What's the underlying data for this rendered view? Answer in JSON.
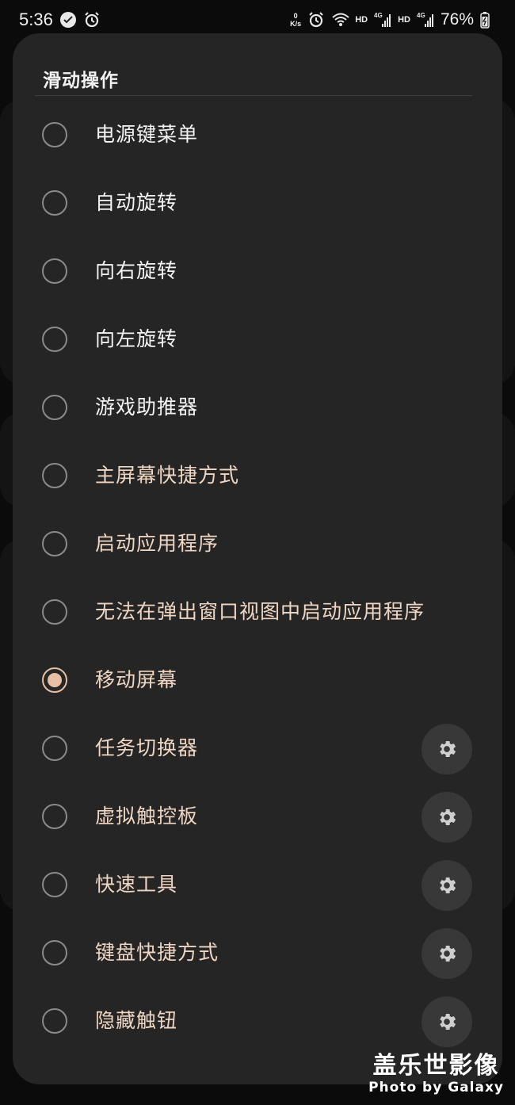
{
  "status_bar": {
    "time": "5:36",
    "net_speed_value": "0",
    "net_speed_unit": "K/s",
    "hd1": "HD",
    "signal1": "4G",
    "hd2": "HD",
    "signal2": "4G",
    "battery": "76%"
  },
  "dialog": {
    "title": "滑动操作",
    "options": [
      {
        "label": "电源键菜单",
        "selected": false,
        "has_settings": false
      },
      {
        "label": "自动旋转",
        "selected": false,
        "has_settings": false
      },
      {
        "label": "向右旋转",
        "selected": false,
        "has_settings": false
      },
      {
        "label": "向左旋转",
        "selected": false,
        "has_settings": false
      },
      {
        "label": "游戏助推器",
        "selected": false,
        "has_settings": false
      },
      {
        "label": "主屏幕快捷方式",
        "selected": false,
        "has_settings": false
      },
      {
        "label": "启动应用程序",
        "selected": false,
        "has_settings": false
      },
      {
        "label": "无法在弹出窗口视图中启动应用程序",
        "selected": false,
        "has_settings": false
      },
      {
        "label": "移动屏幕",
        "selected": true,
        "has_settings": false
      },
      {
        "label": "任务切换器",
        "selected": false,
        "has_settings": true
      },
      {
        "label": "虚拟触控板",
        "selected": false,
        "has_settings": true
      },
      {
        "label": "快速工具",
        "selected": false,
        "has_settings": true
      },
      {
        "label": "键盘快捷方式",
        "selected": false,
        "has_settings": true
      },
      {
        "label": "隐藏触钮",
        "selected": false,
        "has_settings": true
      }
    ]
  },
  "watermark": {
    "line1": "盖乐世影像",
    "line2": "Photo by Galaxy"
  },
  "colors": {
    "dialog_bg": "#252525",
    "accent": "#e6bfa4",
    "label_tan": "#efd6c2",
    "label_white": "#f4f4f4"
  }
}
